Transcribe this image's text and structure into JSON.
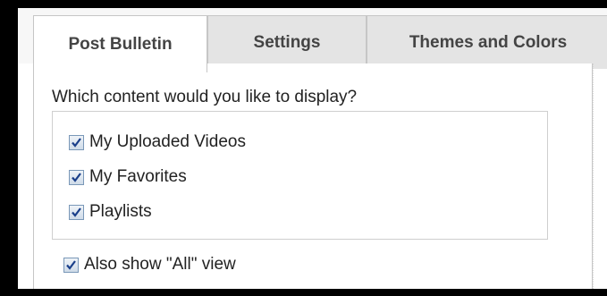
{
  "tabs": [
    {
      "label": "Post Bulletin",
      "active": true
    },
    {
      "label": "Settings",
      "active": false
    },
    {
      "label": "Themes and Colors",
      "active": false
    }
  ],
  "content": {
    "question": "Which content would you like to display?",
    "options": [
      {
        "label": "My Uploaded Videos",
        "checked": true
      },
      {
        "label": "My Favorites",
        "checked": true
      },
      {
        "label": "Playlists",
        "checked": true
      }
    ],
    "all_view": {
      "label": "Also show \"All\" view",
      "checked": true
    }
  },
  "colors": {
    "tab_bg": "#e4e4e4",
    "checkbox_check": "#1a3f8a"
  }
}
